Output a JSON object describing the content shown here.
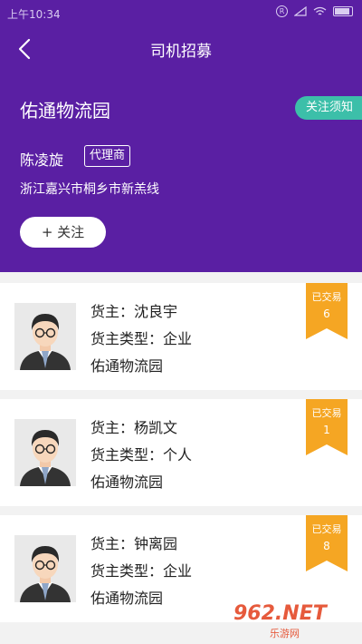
{
  "status_bar": {
    "time": "上午10:34"
  },
  "header": {
    "title": "司机招募"
  },
  "profile": {
    "park_name": "佑通物流园",
    "notice_label": "关注须知",
    "owner_name": "陈凌旋",
    "badge": "代理商",
    "address": "浙江嘉兴市桐乡市新羔线",
    "follow_label": "+ 关注"
  },
  "cards": [
    {
      "owner_line": "货主：沈良宇",
      "type_line": "货主类型：企业",
      "company": "佑通物流园",
      "traded_label": "已交易",
      "count": "6"
    },
    {
      "owner_line": "货主：杨凯文",
      "type_line": "货主类型：个人",
      "company": "佑通物流园",
      "traded_label": "已交易",
      "count": "1"
    },
    {
      "owner_line": "货主：钟离园",
      "type_line": "货主类型：企业",
      "company": "佑通物流园",
      "traded_label": "已交易",
      "count": "8"
    }
  ],
  "watermark": {
    "logo": "962.NET",
    "sub": "乐游网"
  },
  "colors": {
    "header": "#5a1fa3",
    "notice": "#3cbfa9",
    "ribbon": "#f5a623"
  },
  "icons": {
    "back": "back-arrow-icon",
    "avatar": "avatar-icon"
  }
}
